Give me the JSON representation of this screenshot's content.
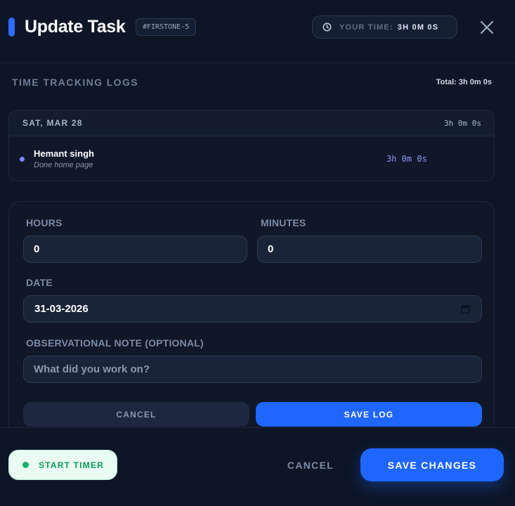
{
  "header": {
    "title": "Update Task",
    "task_code": "#FIRSTONE-5",
    "your_time_label": "YOUR TIME:",
    "your_time_value": "3H 0M 0S"
  },
  "logs": {
    "section_title": "TIME TRACKING LOGS",
    "total": "Total: 3h 0m 0s",
    "groups": [
      {
        "date": "SAT, MAR 28",
        "day_total": "3h 0m 0s",
        "entries": [
          {
            "user": "Hemant singh",
            "note": "Done home page",
            "duration": "3h 0m 0s"
          }
        ]
      }
    ]
  },
  "form": {
    "hours_label": "HOURS",
    "hours_value": "0",
    "minutes_label": "MINUTES",
    "minutes_value": "0",
    "date_label": "DATE",
    "date_value": "31-03-2026",
    "note_label": "OBSERVATIONAL NOTE (OPTIONAL)",
    "note_placeholder": "What did you work on?",
    "cancel_label": "CANCEL",
    "save_label": "SAVE LOG"
  },
  "footer": {
    "start_timer_label": "START TIMER",
    "cancel_label": "CANCEL",
    "save_changes_label": "SAVE CHANGES"
  },
  "colors": {
    "accent": "#1f66ff",
    "background": "#0d1527",
    "timer_green": "#12b06b"
  }
}
